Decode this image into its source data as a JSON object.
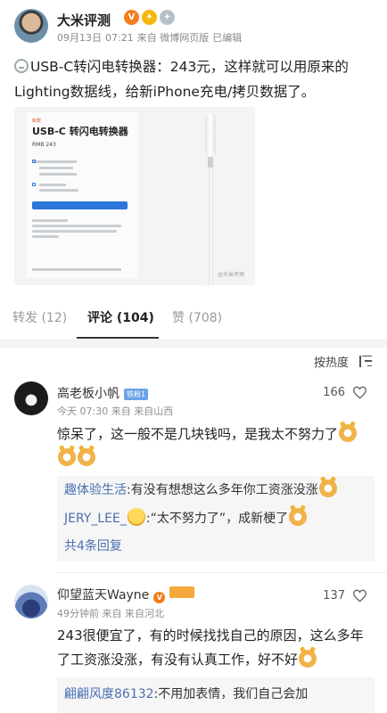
{
  "post": {
    "author": "大米评测",
    "badge_icons": [
      "verified-icon",
      "medal-icon",
      "silver-medal-icon"
    ],
    "date": "09月13日",
    "time": "07:21",
    "source": "来自 微博网页版",
    "edited": "已编辑",
    "text": "USB-C转闪电转换器：243元，这样就可以用原来的Lighting数据线，给新iPhone充电/拷贝数据了。",
    "image": {
      "title": "USB-C 转闪电转换器",
      "price": "RMB 243",
      "watermark": "@大米评测"
    }
  },
  "tabs": [
    {
      "label": "转发 (12)",
      "active": false
    },
    {
      "label": "评论 (104)",
      "active": true
    },
    {
      "label": "赞 (708)",
      "active": false
    }
  ],
  "sort": {
    "label": "按热度",
    "icon": "sort-icon"
  },
  "comments": [
    {
      "name": "高老板小帆",
      "badge": "铁粉1",
      "date": "今天",
      "time": "07:30",
      "source": "来自",
      "location": "来自山西",
      "likes": "166",
      "text": "惊呆了，这一般不是几块钱吗，是我太不努力了",
      "replies": [
        {
          "user": "趣体验生活",
          "text": ":有没有想想这么多年你工资涨没涨"
        },
        {
          "user": "JERY_LEE_",
          "text": ":“太不努力了”，成新梗了"
        }
      ],
      "more": "共4条回复"
    },
    {
      "name": "仰望蓝天Wayne",
      "badge": "",
      "date": "49分钟前",
      "source": "来自",
      "location": "来自河北",
      "likes": "137",
      "text": "243很便宜了，有的时候找找自己的原因，这么多年了工资涨没涨，有没有认真工作，好不好",
      "replies": [
        {
          "user": "翩翩风度86132",
          "text": ":不用加表情，我们自己会加"
        }
      ]
    }
  ],
  "colors": {
    "link_blue": "#4a6fb0",
    "badge_orange": "#f27e1e",
    "tab_active": "#222222",
    "tab_inactive": "#9a9a9a"
  }
}
